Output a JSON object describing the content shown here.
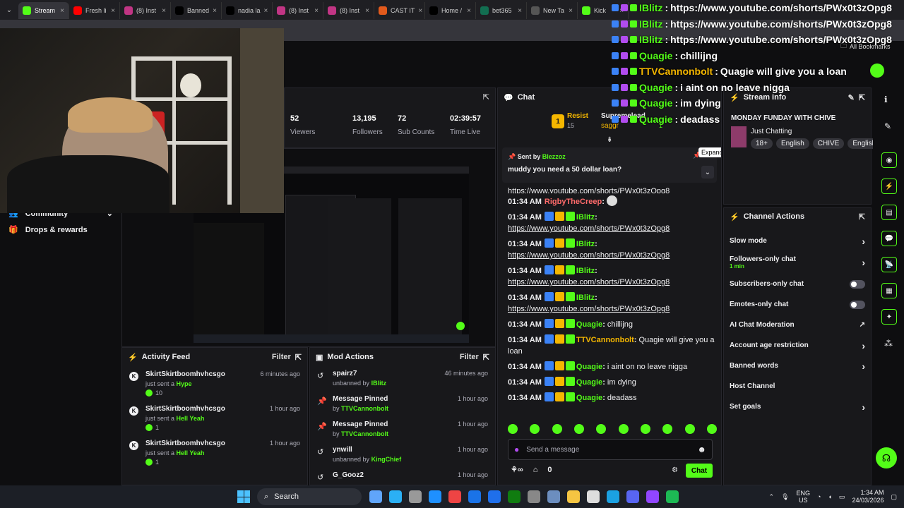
{
  "tabs": [
    {
      "label": "Stream",
      "icon": "kick-icon",
      "color": "#53fc18",
      "active": true
    },
    {
      "label": "Fresh li",
      "icon": "youtube-icon",
      "color": "#ff0000"
    },
    {
      "label": "(8) Inst",
      "icon": "instagram-icon",
      "color": "#c13584"
    },
    {
      "label": "Banned",
      "icon": "x-icon",
      "color": "#000000"
    },
    {
      "label": "nadia la",
      "icon": "x-icon",
      "color": "#000000"
    },
    {
      "label": "(8) Inst",
      "icon": "instagram-icon",
      "color": "#c13584"
    },
    {
      "label": "(8) Inst",
      "icon": "instagram-icon",
      "color": "#c13584"
    },
    {
      "label": "CAST IT",
      "icon": "cast-icon",
      "color": "#e25a1c"
    },
    {
      "label": "Home /",
      "icon": "x-icon",
      "color": "#000000"
    },
    {
      "label": "bet365",
      "icon": "bet365-icon",
      "color": "#126e51"
    },
    {
      "label": "New Ta",
      "icon": "chrome-icon",
      "color": "#555555"
    },
    {
      "label": "Kick",
      "icon": "kick-icon",
      "color": "#53fc18"
    }
  ],
  "bookmarks_label": "All Bookmarks",
  "overlay_chat": [
    {
      "user": "IBlitz",
      "user_color": "#53fc18",
      "text": "https://www.youtube.com/shorts/PWx0t3zOpg8"
    },
    {
      "user": "IBlitz",
      "user_color": "#53fc18",
      "text": "https://www.youtube.com/shorts/PWx0t3zOpg8"
    },
    {
      "user": "IBlitz",
      "user_color": "#53fc18",
      "text": "https://www.youtube.com/shorts/PWx0t3zOpg8"
    },
    {
      "user": "Quagie",
      "user_color": "#53fc18",
      "text": "chillijng"
    },
    {
      "user": "TTVCannonbolt",
      "user_color": "#f5b700",
      "text": "Quagie will give you a loan"
    },
    {
      "user": "Quagie",
      "user_color": "#53fc18",
      "text": "i aint on no leave nigga"
    },
    {
      "user": "Quagie",
      "user_color": "#53fc18",
      "text": "im dying"
    },
    {
      "user": "Quagie",
      "user_color": "#53fc18",
      "text": "deadass"
    }
  ],
  "sidebar": {
    "community": "Community",
    "drops": "Drops & rewards"
  },
  "stats": [
    {
      "value": "52",
      "label": "Viewers"
    },
    {
      "value": "13,195",
      "label": "Followers"
    },
    {
      "value": "72",
      "label": "Sub Counts"
    },
    {
      "value": "02:39:57",
      "label": "Time Live"
    }
  ],
  "activity_feed": {
    "title": "Activity Feed",
    "filter": "Filter",
    "items": [
      {
        "user": "SkirtSkirtboomhvhcsgo",
        "action": "just sent a",
        "gift": "Hype",
        "amount": "10",
        "time": "6 minutes ago"
      },
      {
        "user": "SkirtSkirtboomhvhcsgo",
        "action": "just sent a",
        "gift": "Hell Yeah",
        "amount": "1",
        "time": "1 hour ago"
      },
      {
        "user": "SkirtSkirtboomhvhcsgo",
        "action": "just sent a",
        "gift": "Hell Yeah",
        "amount": "1",
        "time": "1 hour ago"
      }
    ]
  },
  "mod_actions": {
    "title": "Mod Actions",
    "filter": "Filter",
    "items": [
      {
        "title": "spairz7",
        "detail": "unbanned by",
        "by": "IBlitz",
        "time": "46 minutes ago",
        "icon": "unban-icon"
      },
      {
        "title": "Message Pinned",
        "detail": "by",
        "by": "TTVCannonbolt",
        "time": "1 hour ago",
        "icon": "pin-icon"
      },
      {
        "title": "Message Pinned",
        "detail": "by",
        "by": "TTVCannonbolt",
        "time": "1 hour ago",
        "icon": "pin-icon"
      },
      {
        "title": "ynwill",
        "detail": "unbanned by",
        "by": "KingChief",
        "time": "1 hour ago",
        "icon": "unban-icon"
      },
      {
        "title": "G_Gooz2",
        "detail": "",
        "by": "",
        "time": "1 hour ago",
        "icon": "unban-icon"
      }
    ]
  },
  "chat": {
    "title": "Chat",
    "leaderboard": [
      {
        "rank": "1",
        "name": "Resist",
        "count": "15"
      },
      {
        "name": "Supremelead",
        "count": ""
      },
      {
        "name": "saggr",
        "count": "1"
      }
    ],
    "pinned": {
      "sent_by_label": "Sent by",
      "sender": "Blezzoz",
      "text": "muddy you need a 50 dollar loan?",
      "expand_tooltip": "Expand"
    },
    "partial_top": "https://www.youtube.com/shorts/PWx0t3zOpg8",
    "messages": [
      {
        "time": "01:34 AM",
        "user": "RigbyTheCreep",
        "user_color": "#ff6b6b",
        "text": "",
        "emote": true
      },
      {
        "time": "01:34 AM",
        "user": "IBlitz",
        "user_color": "#53fc18",
        "text": "https://www.youtube.com/shorts/PWx0t3zOpg8"
      },
      {
        "time": "01:34 AM",
        "user": "IBlitz",
        "user_color": "#53fc18",
        "text": "https://www.youtube.com/shorts/PWx0t3zOpg8"
      },
      {
        "time": "01:34 AM",
        "user": "IBlitz",
        "user_color": "#53fc18",
        "text": "https://www.youtube.com/shorts/PWx0t3zOpg8"
      },
      {
        "time": "01:34 AM",
        "user": "IBlitz",
        "user_color": "#53fc18",
        "text": "https://www.youtube.com/shorts/PWx0t3zOpg8"
      },
      {
        "time": "01:34 AM",
        "user": "Quagie",
        "user_color": "#53fc18",
        "text": "chillijng"
      },
      {
        "time": "01:34 AM",
        "user": "TTVCannonbolt",
        "user_color": "#f5b700",
        "text": "Quagie will give you a loan"
      },
      {
        "time": "01:34 AM",
        "user": "Quagie",
        "user_color": "#53fc18",
        "text": "i aint on no leave nigga"
      },
      {
        "time": "01:34 AM",
        "user": "Quagie",
        "user_color": "#53fc18",
        "text": "im dying"
      },
      {
        "time": "01:34 AM",
        "user": "Quagie",
        "user_color": "#53fc18",
        "text": "deadass"
      }
    ],
    "input_placeholder": "Send a message",
    "points": "0",
    "send_label": "Chat"
  },
  "stream_info": {
    "title": "Stream info",
    "stream_title": "MONDAY FUNDAY WITH CHIVE",
    "category": "Just Chatting",
    "tags": [
      "18+",
      "English",
      "CHIVE",
      "English"
    ]
  },
  "channel_actions": {
    "title": "Channel Actions",
    "items": [
      {
        "label": "Slow mode",
        "control": "chevron"
      },
      {
        "label": "Followers-only chat",
        "sub": "1 min",
        "control": "chevron"
      },
      {
        "label": "Subscribers-only chat",
        "control": "toggle"
      },
      {
        "label": "Emotes-only chat",
        "control": "toggle"
      },
      {
        "label": "AI Chat Moderation",
        "control": "external"
      },
      {
        "label": "Account age restriction",
        "control": "chevron"
      },
      {
        "label": "Banned words",
        "control": "chevron"
      },
      {
        "label": "Host Channel",
        "control": "none"
      },
      {
        "label": "Set goals",
        "control": "chevron"
      }
    ]
  },
  "taskbar": {
    "search": "Search",
    "lang_top": "ENG",
    "lang_bottom": "US",
    "time": "1:34 AM",
    "date": "24/03/2026"
  },
  "colors": {
    "accent": "#53fc18",
    "panel": "#18181b",
    "bg": "#0e0e10"
  }
}
